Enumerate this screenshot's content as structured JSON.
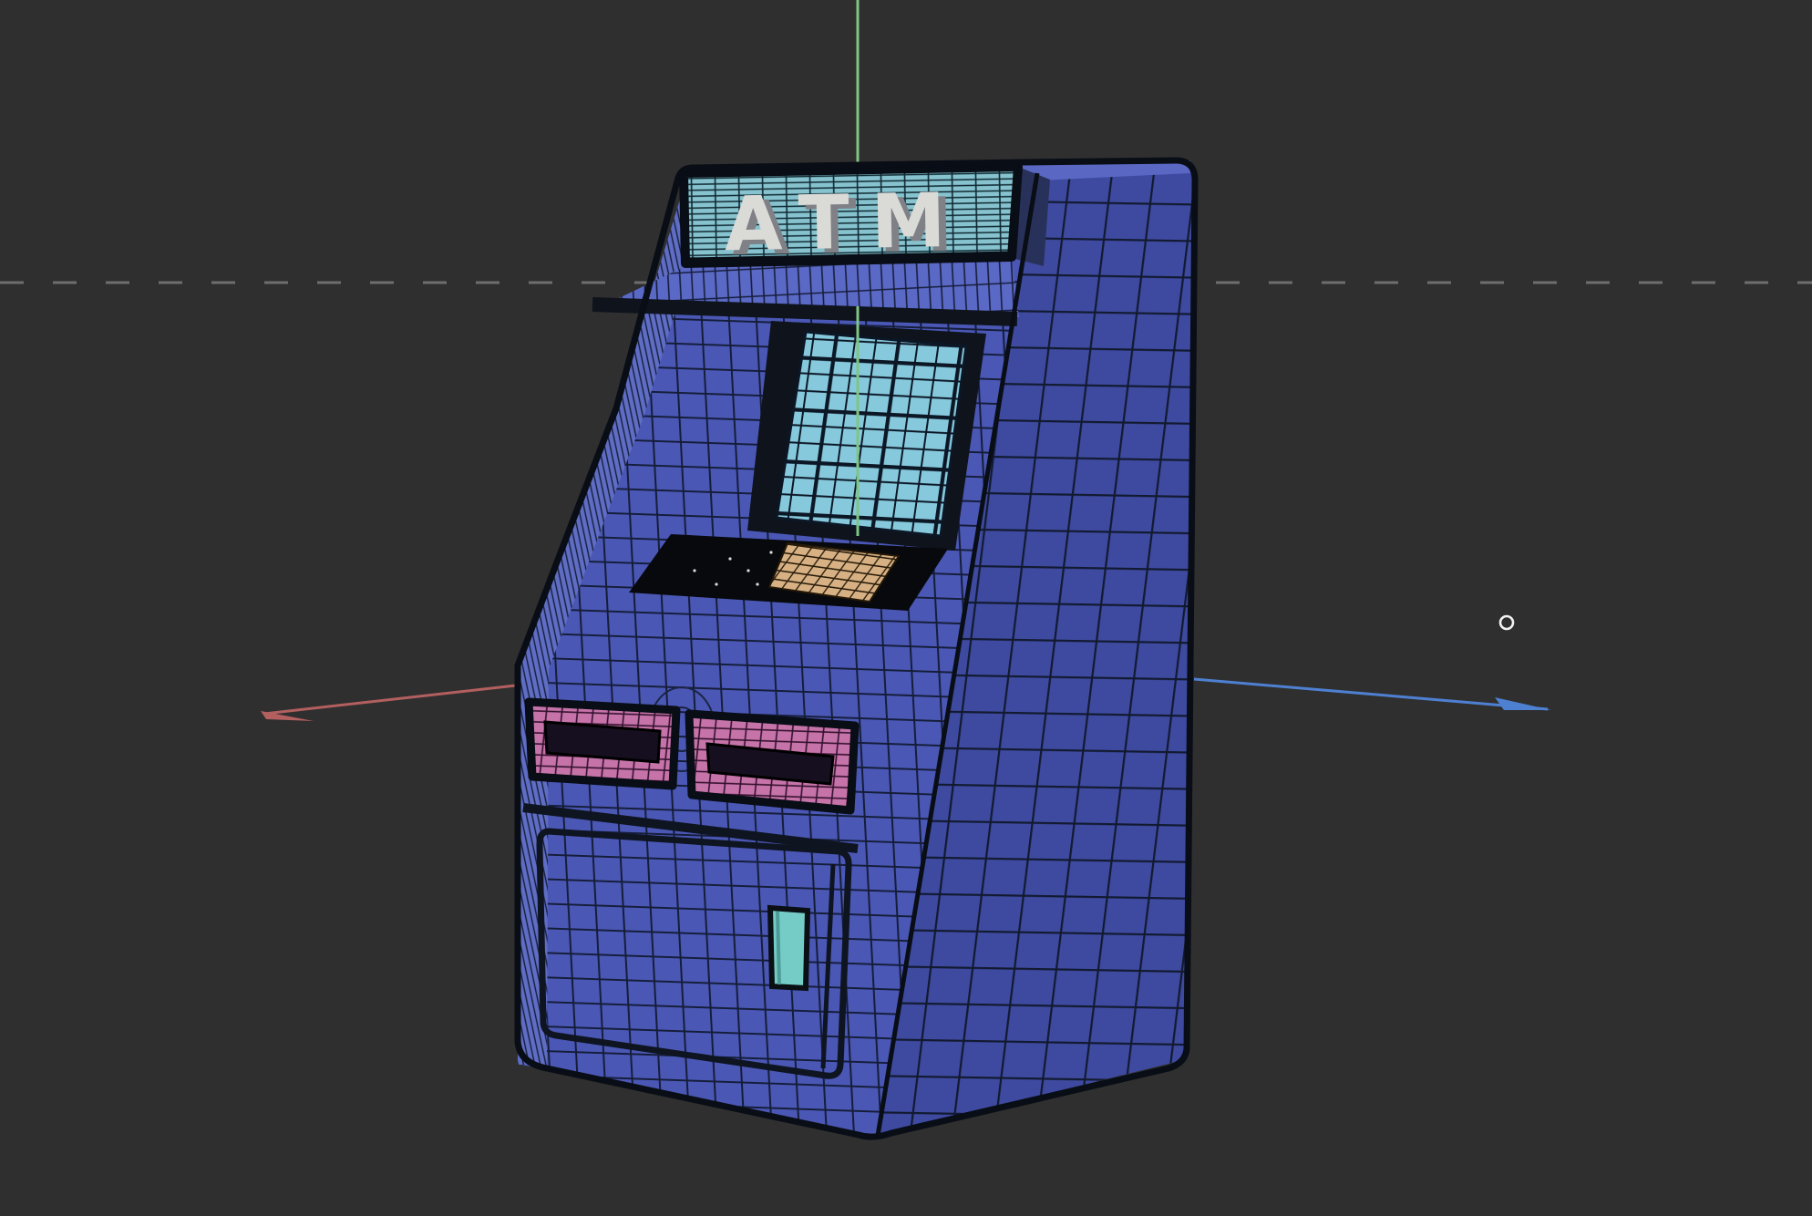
{
  "viewport": {
    "type": "3d-viewport",
    "background_color": "#2f2f2f",
    "horizon_line": {
      "style": "dashed",
      "color": "#6e6e6e"
    },
    "axes": {
      "vertical_axis_color": "#7fc584",
      "left_axis_color": "#b35f5f",
      "right_axis_color": "#4e80d2"
    },
    "cursor": {
      "shape": "circle-outline",
      "color": "#f2f2f2"
    }
  },
  "model": {
    "name": "ATM machine (wireframe shaded)",
    "sign_text": "ATM",
    "colors": {
      "body_front": "#4a57b4",
      "body_side": "#3e4aa0",
      "body_top": "#5a68c4",
      "body_left_band": "#5f6dc4",
      "body_fan_band": "#5b69c6",
      "wire_front": "#151d3a",
      "wire_side": "#121a31",
      "sign_panel": "#86c3ce",
      "sign_wire": "#0f2832",
      "sign_side": "#283159",
      "sign_letters": "#dadad6",
      "sign_letter_shadow": "#808187",
      "sign_letter_outline": "#16191f",
      "hood_bezel": "#0e131c",
      "screen": "#86c9dc",
      "screen_wire": "#0c1726",
      "keypad_base": "#07090d",
      "keypad_keys": "#d7b183",
      "keypad_wire": "#241808",
      "slot_pink": "#c573a8",
      "slot_pink_wire": "#33102e",
      "slot_opening": "#160f20",
      "receipt_slot": "#75ccc7",
      "receipt_slot_shade": "#4d9b97",
      "door_line": "#0e1420",
      "outline": "#090d15"
    }
  }
}
